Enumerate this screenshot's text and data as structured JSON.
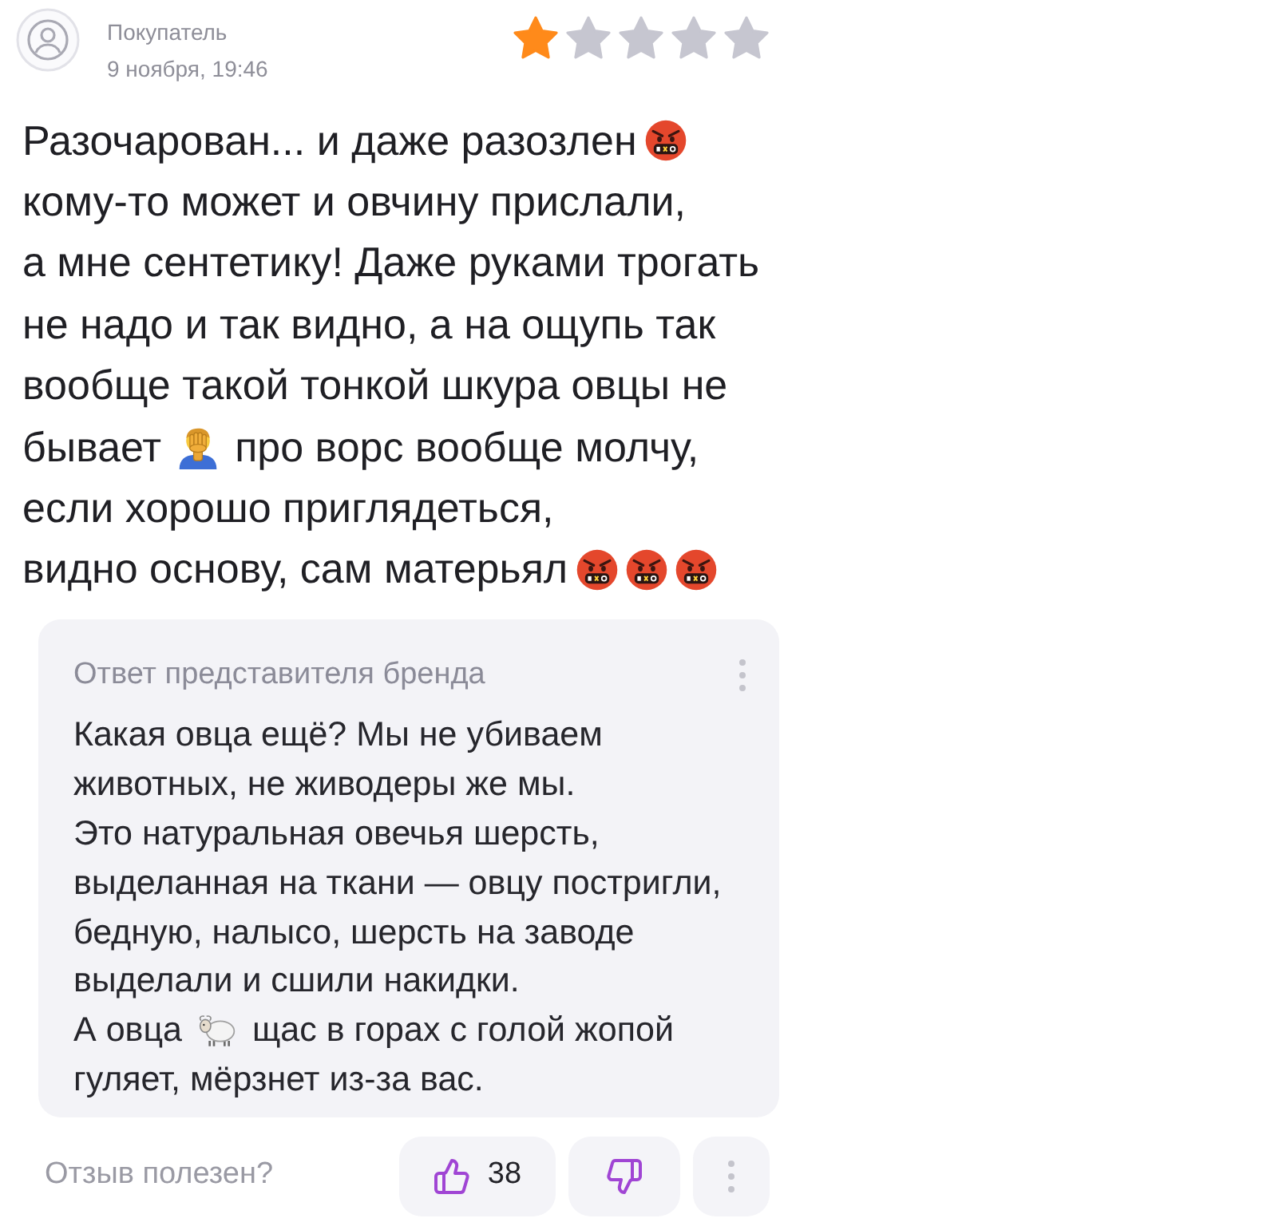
{
  "author": {
    "name": "Покупатель",
    "date": "9 ноября, 19:46"
  },
  "review": {
    "stars": 1,
    "lines": [
      {
        "parts": [
          {
            "kind": "text",
            "text": "Разочарован... и даже разозлен"
          },
          {
            "kind": "angry"
          }
        ]
      },
      {
        "parts": [
          {
            "kind": "text",
            "text": "кому-то может и овчину прислали,"
          }
        ]
      },
      {
        "parts": [
          {
            "kind": "text",
            "text": "а мне сентетику! Даже руками трогать"
          }
        ]
      },
      {
        "parts": [
          {
            "kind": "text",
            "text": "не надо и так видно, а на ощупь так"
          }
        ]
      },
      {
        "parts": [
          {
            "kind": "text",
            "text": "вообще такой тонкой шкура овцы не"
          }
        ]
      },
      {
        "parts": [
          {
            "kind": "text",
            "text": "бывает"
          },
          {
            "kind": "facepalm"
          },
          {
            "kind": "text",
            "text": "про ворс вообще молчу,"
          }
        ]
      },
      {
        "parts": [
          {
            "kind": "text",
            "text": "если хорошо приглядеться,"
          }
        ]
      },
      {
        "parts": [
          {
            "kind": "text",
            "text": "видно основу, сам матерьял"
          },
          {
            "kind": "angry"
          },
          {
            "kind": "angry"
          },
          {
            "kind": "angry"
          }
        ]
      }
    ]
  },
  "brand_reply": {
    "title": "Ответ представителя бренда",
    "lines": [
      {
        "parts": [
          {
            "kind": "text",
            "text": "Какая овца ещё? Мы не убиваем"
          }
        ]
      },
      {
        "parts": [
          {
            "kind": "text",
            "text": "животных, не живодеры же мы."
          }
        ]
      },
      {
        "parts": [
          {
            "kind": "text",
            "text": "Это натуральная овечья шерсть,"
          }
        ]
      },
      {
        "parts": [
          {
            "kind": "text",
            "text": "выделанная на ткани — овцу постригли,"
          }
        ]
      },
      {
        "parts": [
          {
            "kind": "text",
            "text": "бедную, налысо, шерсть на заводе"
          }
        ]
      },
      {
        "parts": [
          {
            "kind": "text",
            "text": "выделали и сшили накидки."
          }
        ]
      },
      {
        "parts": [
          {
            "kind": "text",
            "text": "А овца"
          },
          {
            "kind": "sheep"
          },
          {
            "kind": "text",
            "text": "щас в горах с голой жопой"
          }
        ]
      },
      {
        "parts": [
          {
            "kind": "text",
            "text": "гуляет, мёрзнет из-за вас."
          }
        ]
      }
    ]
  },
  "footer": {
    "question": "Отзыв полезен?",
    "likes": "38"
  }
}
